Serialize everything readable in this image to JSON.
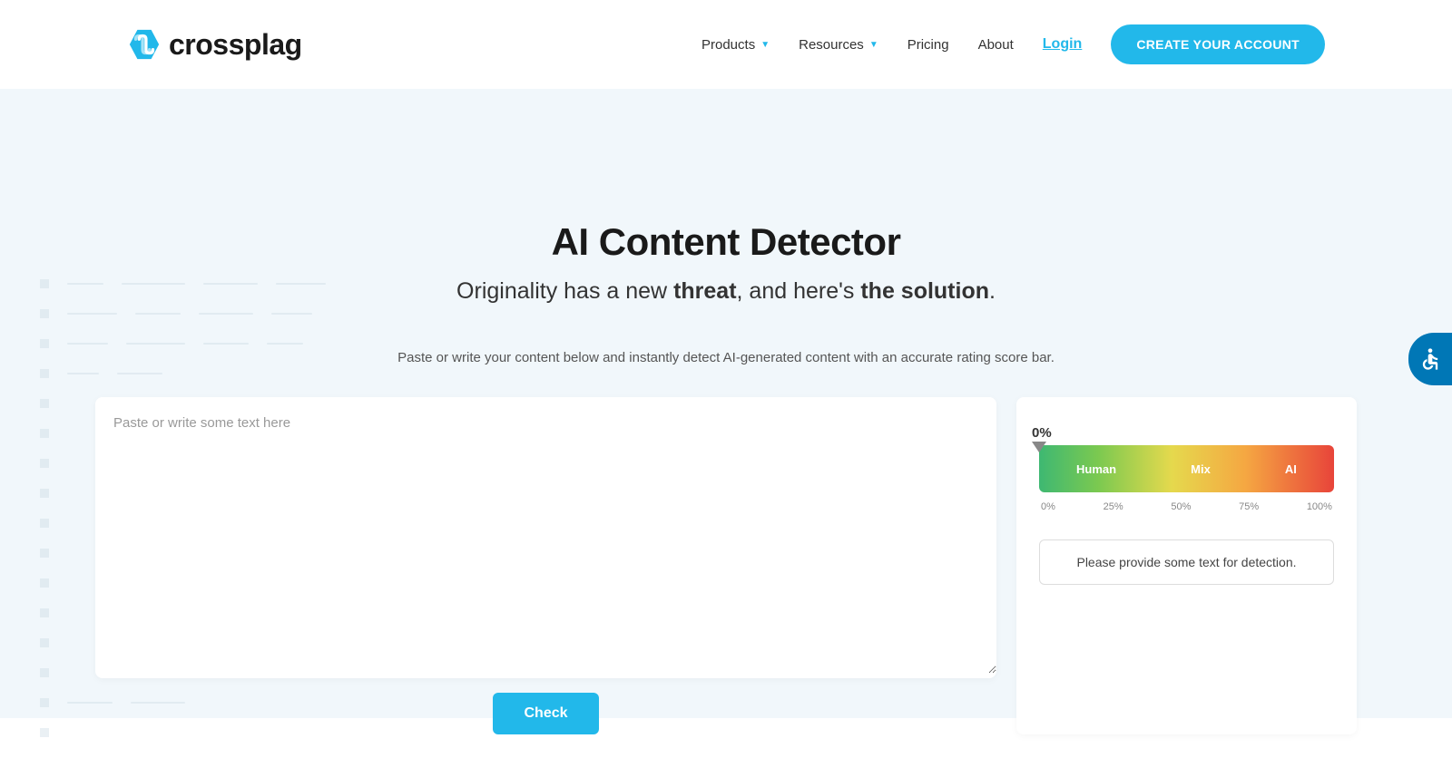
{
  "header": {
    "logo_text": "crossplag",
    "nav": {
      "products": "Products",
      "resources": "Resources",
      "pricing": "Pricing",
      "about": "About",
      "login": "Login",
      "cta": "CREATE YOUR ACCOUNT"
    }
  },
  "hero": {
    "title": "AI Content Detector",
    "subtitle_pre": "Originality has a new ",
    "subtitle_bold1": "threat",
    "subtitle_mid": ", and here's ",
    "subtitle_bold2": "the solution",
    "subtitle_end": ".",
    "description": "Paste or write your content below and instantly detect AI-generated content with an accurate rating score bar."
  },
  "textarea": {
    "placeholder": "Paste or write some text here",
    "value": ""
  },
  "check_button": "Check",
  "results": {
    "score": "0%",
    "bar_labels": {
      "human": "Human",
      "mix": "Mix",
      "ai": "AI"
    },
    "ticks": {
      "t0": "0%",
      "t25": "25%",
      "t50": "50%",
      "t75": "75%",
      "t100": "100%"
    },
    "message": "Please provide some text for detection."
  }
}
